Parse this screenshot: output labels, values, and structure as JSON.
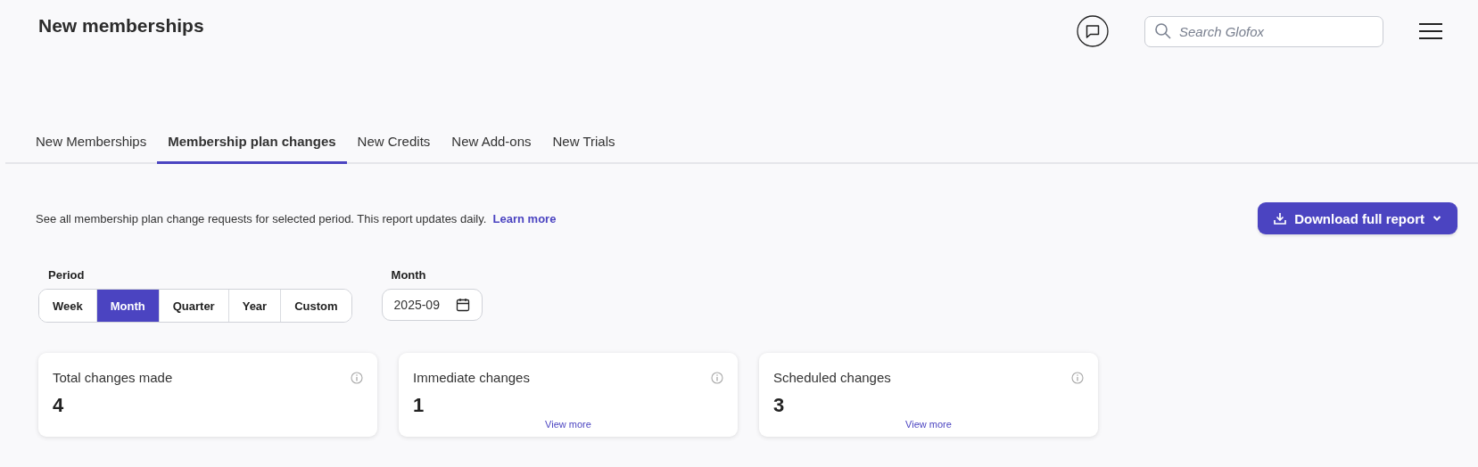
{
  "header": {
    "title": "New memberships",
    "search": {
      "placeholder": "Search Glofox"
    }
  },
  "tabs": [
    {
      "label": "New Memberships",
      "selected": false
    },
    {
      "label": "Membership plan changes",
      "selected": true
    },
    {
      "label": "New Credits",
      "selected": false
    },
    {
      "label": "New Add-ons",
      "selected": false
    },
    {
      "label": "New Trials",
      "selected": false
    }
  ],
  "description": {
    "text": "See all membership plan change requests for selected period. This report updates daily.",
    "link": "Learn more"
  },
  "download_button": {
    "label": "Download full report"
  },
  "period": {
    "label": "Period",
    "options": [
      {
        "label": "Week",
        "selected": false
      },
      {
        "label": "Month",
        "selected": true
      },
      {
        "label": "Quarter",
        "selected": false
      },
      {
        "label": "Year",
        "selected": false
      },
      {
        "label": "Custom",
        "selected": false
      }
    ]
  },
  "month": {
    "label": "Month",
    "value": "2025-09"
  },
  "cards": [
    {
      "title": "Total changes made",
      "value": "4"
    },
    {
      "title": "Immediate changes",
      "value": "1",
      "link": "View more"
    },
    {
      "title": "Scheduled changes",
      "value": "3",
      "link": "View more"
    }
  ]
}
